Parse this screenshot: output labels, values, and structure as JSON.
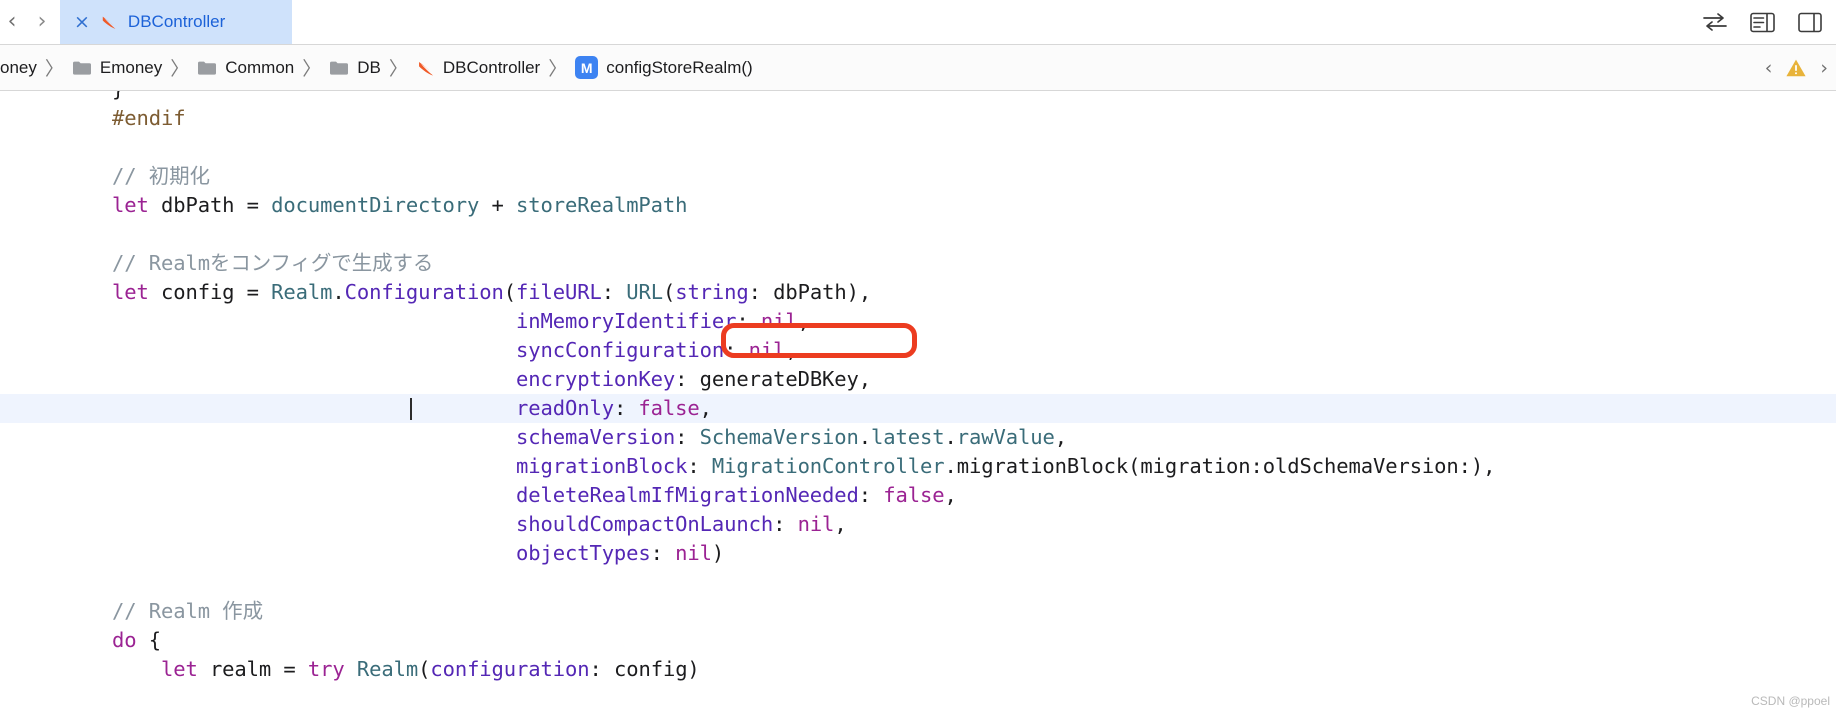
{
  "window": {
    "app": "Xcode"
  },
  "tabbar": {
    "back_arrow": "‹",
    "forward_arrow": "›",
    "close_label": "×",
    "tab_title": "DBController",
    "tab_icon": "swift-file-icon",
    "icons": [
      {
        "name": "code-review-icon",
        "label": "⇄"
      },
      {
        "name": "inspector-icon",
        "label": "≣"
      },
      {
        "name": "panel-toggle-icon",
        "label": "▥"
      }
    ]
  },
  "breadcrumb": {
    "items": [
      {
        "label": "oney",
        "icon": "none"
      },
      {
        "label": "Emoney",
        "icon": "folder-icon"
      },
      {
        "label": "Common",
        "icon": "folder-icon"
      },
      {
        "label": "DB",
        "icon": "folder-icon"
      },
      {
        "label": "DBController",
        "icon": "swift-file-icon"
      },
      {
        "label": "configStoreRealm()",
        "icon": "method-badge",
        "badge": "M"
      }
    ],
    "separator": "〉",
    "prev_label": "‹",
    "next_label": "›",
    "warning_icon": "warning-triangle-icon"
  },
  "editor": {
    "language": "swift",
    "colors": {
      "keyword": "#9b2393",
      "type": "#3a6c79",
      "parameter": "#5427b5",
      "comment": "#8a96a0",
      "literal": "#9b2393",
      "preprocessor": "#7d5c32",
      "plain": "#1c1c1e",
      "line_highlight": "#eff4fe",
      "annotation": "#ec3c20"
    },
    "lines": [
      {
        "id": "l0",
        "text": "}"
      },
      {
        "id": "l1",
        "text": "#endif"
      },
      {
        "id": "l2",
        "text": ""
      },
      {
        "id": "l3",
        "text": "// 初期化"
      },
      {
        "id": "l4",
        "text": "let dbPath = documentDirectory + storeRealmPath"
      },
      {
        "id": "l5",
        "text": ""
      },
      {
        "id": "l6",
        "text": "// Realmをコンフィグで生成する"
      },
      {
        "id": "l7",
        "text": "let config = Realm.Configuration(fileURL: URL(string: dbPath),"
      },
      {
        "id": "l8",
        "text": "                                 inMemoryIdentifier: nil,"
      },
      {
        "id": "l9",
        "text": "                                 syncConfiguration: nil,"
      },
      {
        "id": "l10",
        "text": "                                 encryptionKey: generateDBKey,"
      },
      {
        "id": "l11",
        "text": "                                 readOnly: false,"
      },
      {
        "id": "l12",
        "text": "                                 schemaVersion: SchemaVersion.latest.rawValue,"
      },
      {
        "id": "l13",
        "text": "                                 migrationBlock: MigrationController.migrationBlock(migration:oldSchemaVersion:),"
      },
      {
        "id": "l14",
        "text": "                                 deleteRealmIfMigrationNeeded: false,"
      },
      {
        "id": "l15",
        "text": "                                 shouldCompactOnLaunch: nil,"
      },
      {
        "id": "l16",
        "text": "                                 objectTypes: nil)"
      },
      {
        "id": "l17",
        "text": ""
      },
      {
        "id": "l18",
        "text": "// Realm 作成"
      },
      {
        "id": "l19",
        "text": "do {"
      },
      {
        "id": "l20",
        "text": "    let realm = try Realm(configuration: config)"
      }
    ],
    "highlighted_line": "readOnly: false,",
    "annotated_text": "generateDBKey,"
  },
  "watermark": "CSDN @ppoel"
}
